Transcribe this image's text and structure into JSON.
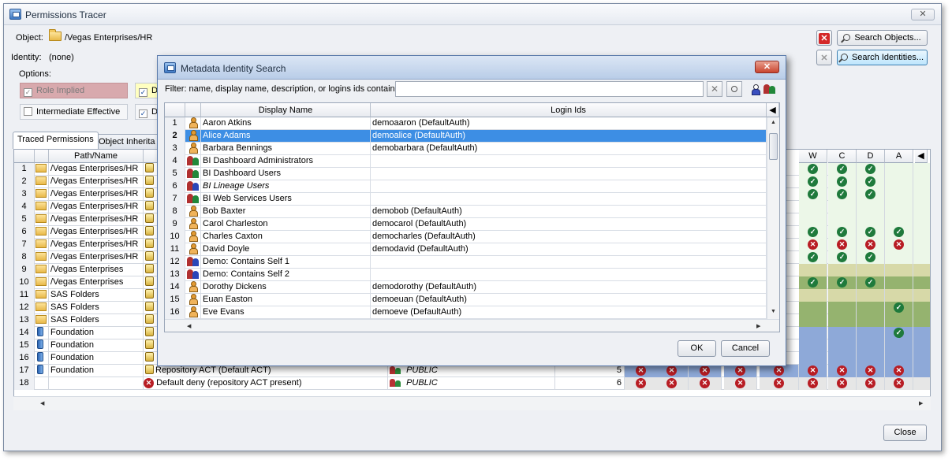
{
  "window": {
    "title": "Permissions Tracer",
    "close_glyph": "✕"
  },
  "object": {
    "label": "Object:",
    "value": "/Vegas Enterprises/HR"
  },
  "identity": {
    "label": "Identity:",
    "value": "(none)"
  },
  "options": {
    "label": "Options:",
    "role_implied": "Role Implied",
    "intermediate_effective": "Intermediate Effective",
    "d_label": "D"
  },
  "buttons": {
    "search_objects": "Search Objects...",
    "search_identities": "Search Identities...",
    "close": "Close",
    "clear_glyph": "✕"
  },
  "tabs": [
    "Traced Permissions",
    "Object Inherita"
  ],
  "traced": {
    "header_path": "Path/Name",
    "perm_columns": [
      "W",
      "C",
      "D",
      "A"
    ],
    "rows": [
      {
        "n": "1",
        "path": "/Vegas Enterprises/HR",
        "icon": "folder"
      },
      {
        "n": "2",
        "path": "/Vegas Enterprises/HR",
        "icon": "folder"
      },
      {
        "n": "3",
        "path": "/Vegas Enterprises/HR",
        "icon": "folder"
      },
      {
        "n": "4",
        "path": "/Vegas Enterprises/HR",
        "icon": "folder"
      },
      {
        "n": "5",
        "path": "/Vegas Enterprises/HR",
        "icon": "folder"
      },
      {
        "n": "6",
        "path": "/Vegas Enterprises/HR",
        "icon": "folder"
      },
      {
        "n": "7",
        "path": "/Vegas Enterprises/HR",
        "icon": "folder"
      },
      {
        "n": "8",
        "path": "/Vegas Enterprises/HR",
        "icon": "folder"
      },
      {
        "n": "9",
        "path": "/Vegas Enterprises",
        "icon": "folder"
      },
      {
        "n": "10",
        "path": "/Vegas Enterprises",
        "icon": "folder"
      },
      {
        "n": "11",
        "path": "SAS Folders",
        "icon": "folder-db"
      },
      {
        "n": "12",
        "path": "SAS Folders",
        "icon": "folder-db"
      },
      {
        "n": "13",
        "path": "SAS Folders",
        "icon": "folder-db"
      },
      {
        "n": "14",
        "path": "Foundation",
        "icon": "repository"
      },
      {
        "n": "15",
        "path": "Foundation",
        "icon": "repository"
      },
      {
        "n": "16",
        "path": "Foundation",
        "icon": "repository"
      },
      {
        "n": "17",
        "path": "Foundation",
        "icon": "repository"
      },
      {
        "n": "18",
        "path": "",
        "icon": ""
      }
    ],
    "row17": {
      "source": "Repository ACT (Default ACT)",
      "identity": "PUBLIC",
      "level": "5"
    },
    "row18": {
      "source": "Default deny (repository ACT present)",
      "identity": "PUBLIC",
      "level": "6"
    },
    "perm_marks": [
      [
        "ok",
        "ok",
        "ok",
        ""
      ],
      [
        "ok",
        "ok",
        "ok",
        ""
      ],
      [
        "ok",
        "ok",
        "ok",
        ""
      ],
      [
        "",
        "",
        "",
        ""
      ],
      [
        "",
        "",
        "",
        ""
      ],
      [
        "ok",
        "ok",
        "ok",
        "ok"
      ],
      [
        "no",
        "no",
        "no",
        "no"
      ],
      [
        "ok",
        "ok",
        "ok",
        ""
      ],
      [
        "",
        "",
        "",
        ""
      ],
      [
        "ok",
        "ok",
        "ok",
        ""
      ],
      [
        "",
        "",
        "",
        ""
      ],
      [
        "",
        "",
        "",
        "ok"
      ],
      [
        "",
        "",
        "",
        ""
      ],
      [
        "",
        "",
        "",
        "ok"
      ],
      [
        "",
        "",
        "",
        ""
      ],
      [
        "",
        "",
        "",
        ""
      ],
      [
        "no",
        "no",
        "no",
        "no"
      ],
      [
        "no",
        "no",
        "no",
        "no"
      ]
    ]
  },
  "dialog": {
    "title": "Metadata Identity Search",
    "close_glyph": "✕",
    "filter_label": "Filter: name, display name, description, or logins ids contain",
    "filter_value": "",
    "col_display": "Display Name",
    "col_login": "Login Ids",
    "ok": "OK",
    "cancel": "Cancel",
    "rows": [
      {
        "n": "1",
        "name": "Aaron Atkins",
        "login": "demoaaron (DefaultAuth)",
        "type": "user"
      },
      {
        "n": "2",
        "name": "Alice Adams",
        "login": "demoalice (DefaultAuth)",
        "type": "user",
        "selected": true
      },
      {
        "n": "3",
        "name": "Barbara Bennings",
        "login": "demobarbara (DefaultAuth)",
        "type": "user"
      },
      {
        "n": "4",
        "name": "BI Dashboard Administrators",
        "login": "",
        "type": "group"
      },
      {
        "n": "5",
        "name": "BI Dashboard Users",
        "login": "",
        "type": "group"
      },
      {
        "n": "6",
        "name": "BI Lineage Users",
        "login": "",
        "type": "group-blue",
        "italic": true
      },
      {
        "n": "7",
        "name": "BI Web Services Users",
        "login": "",
        "type": "group"
      },
      {
        "n": "8",
        "name": "Bob Baxter",
        "login": "demobob (DefaultAuth)",
        "type": "user"
      },
      {
        "n": "9",
        "name": "Carol Charleston",
        "login": "democarol (DefaultAuth)",
        "type": "user"
      },
      {
        "n": "10",
        "name": "Charles Caxton",
        "login": "democharles (DefaultAuth)",
        "type": "user"
      },
      {
        "n": "11",
        "name": "David Doyle",
        "login": "demodavid (DefaultAuth)",
        "type": "user"
      },
      {
        "n": "12",
        "name": "Demo: Contains Self 1",
        "login": "",
        "type": "group-blue"
      },
      {
        "n": "13",
        "name": "Demo: Contains Self 2",
        "login": "",
        "type": "group-blue"
      },
      {
        "n": "14",
        "name": "Dorothy Dickens",
        "login": "demodorothy (DefaultAuth)",
        "type": "user"
      },
      {
        "n": "15",
        "name": "Euan Easton",
        "login": "demoeuan (DefaultAuth)",
        "type": "user"
      },
      {
        "n": "16",
        "name": "Eve Evans",
        "login": "demoeve (DefaultAuth)",
        "type": "user"
      }
    ]
  }
}
